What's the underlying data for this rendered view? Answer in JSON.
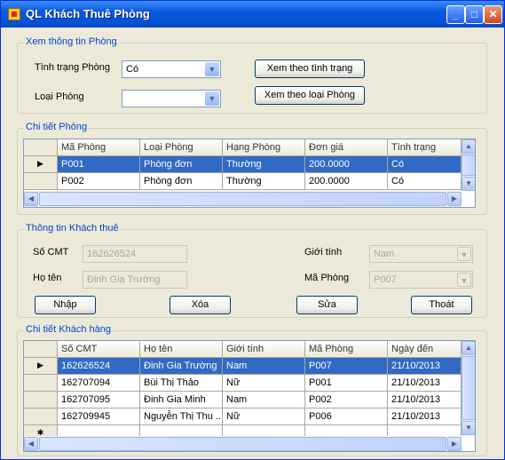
{
  "window": {
    "title": "QL Khách Thuê Phòng",
    "min": "_",
    "max": "□",
    "close": "✕"
  },
  "room_view": {
    "legend": "Xem thông tin Phòng",
    "status_label": "Tình trạng Phòng",
    "status_value": "Có",
    "type_label": "Loại Phòng",
    "type_value": "",
    "btn_by_status": "Xem theo tình trạng",
    "btn_by_type": "Xem theo loại Phòng"
  },
  "room_detail": {
    "legend": "Chi tiết Phòng",
    "columns": [
      "Mã Phòng",
      "Loại Phòng",
      "Hạng Phòng",
      "Đơn giá",
      "Tình trạng"
    ],
    "rows": [
      [
        "P001",
        "Phòng đơn",
        "Thường",
        "200.0000",
        "Có"
      ],
      [
        "P002",
        "Phòng đơn",
        "Thường",
        "200.0000",
        "Có"
      ]
    ]
  },
  "tenant_info": {
    "legend": "Thông tin Khách thuê",
    "cmt_label": "Số CMT",
    "cmt_value": "162626524",
    "name_label": "Họ tên",
    "name_value": "Đinh Gia Trường",
    "gender_label": "Giới tính",
    "gender_value": "Nam",
    "room_label": "Mã Phòng",
    "room_value": "P007",
    "btn_add": "Nhập",
    "btn_delete": "Xóa",
    "btn_edit": "Sửa",
    "btn_exit": "Thoát"
  },
  "tenant_detail": {
    "legend": "Chi tiết Khách hàng",
    "columns": [
      "Số CMT",
      "Họ tên",
      "Giới tính",
      "Mã Phòng",
      "Ngày đến"
    ],
    "rows": [
      [
        "162626524",
        "Đinh Gia Trường",
        "Nam",
        "P007",
        "21/10/2013"
      ],
      [
        "162707094",
        "Bùi Thị Thảo",
        "Nữ",
        "P001",
        "21/10/2013"
      ],
      [
        "162707095",
        "Đinh Gia Minh",
        "Nam",
        "P002",
        "21/10/2013"
      ],
      [
        "162709945",
        "Nguyễn Thị Thu ...",
        "Nữ",
        "P006",
        "21/10/2013"
      ]
    ],
    "new_row_marker": "✱"
  },
  "icons": {
    "current_row": "▶",
    "dropdown": "▼",
    "scroll_up": "▲",
    "scroll_down": "▼",
    "scroll_left": "◀",
    "scroll_right": "▶"
  }
}
